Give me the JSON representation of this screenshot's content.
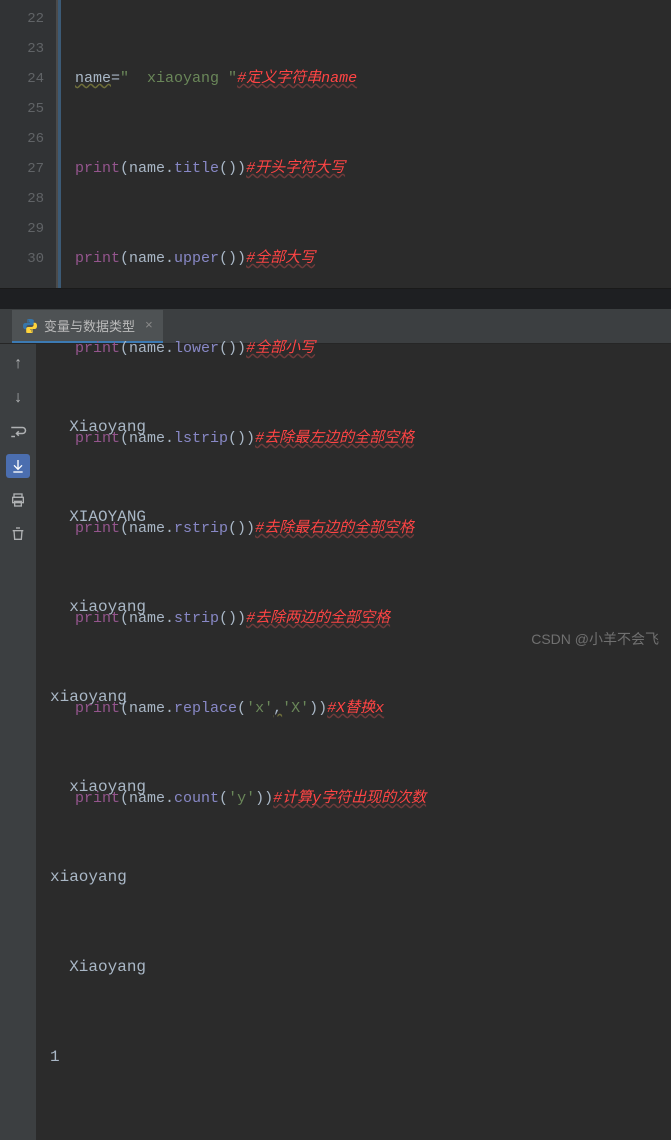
{
  "gutter": [
    "22",
    "23",
    "24",
    "25",
    "26",
    "27",
    "28",
    "29",
    "30"
  ],
  "code": {
    "l22": {
      "a": "name",
      "b": "=",
      "c": "\"  xiaoyang \"",
      "d": "#定义字符串name"
    },
    "l23": {
      "a": "print",
      "b": "(name.",
      "c": "title",
      "d": "())",
      "e": "#开头字符大写"
    },
    "l24": {
      "a": "print",
      "b": "(name.",
      "c": "upper",
      "d": "())",
      "e": "#全部大写"
    },
    "l25": {
      "a": "print",
      "b": "(name.",
      "c": "lower",
      "d": "())",
      "e": "#全部小写"
    },
    "l26": {
      "a": "print",
      "b": "(name.",
      "c": "lstrip",
      "d": "())",
      "e": "#去除最左边的全部空格"
    },
    "l27": {
      "a": "print",
      "b": "(name.",
      "c": "rstrip",
      "d": "())",
      "e": "#去除最右边的全部空格"
    },
    "l28": {
      "a": "print",
      "b": "(name.",
      "c": "strip",
      "d": "())",
      "e": "#去除两边的全部空格"
    },
    "l29": {
      "a": "print",
      "b": "(name.",
      "c": "replace",
      "d": "(",
      "e": "'x'",
      "f": ",",
      "g": "'X'",
      "h": "))",
      "i": "#X替换x"
    },
    "l30": {
      "a": "print",
      "b": "(name.",
      "c": "count",
      "d": "(",
      "e": "'y'",
      "f": "))",
      "g": "#计算y字符出现的次数"
    }
  },
  "tab": {
    "label": "变量与数据类型",
    "close": "×"
  },
  "output": [
    "  Xiaoyang ",
    "  XIAOYANG ",
    "  xiaoyang ",
    "xiaoyang ",
    "  xiaoyang",
    "xiaoyang",
    "  Xiaoyang ",
    "1"
  ],
  "watermark": "CSDN @小羊不会飞"
}
